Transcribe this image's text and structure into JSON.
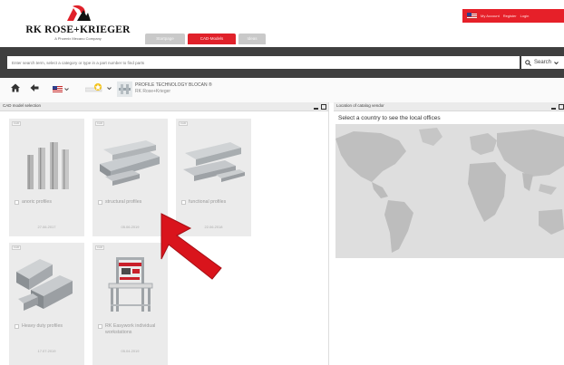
{
  "brand": {
    "name": "RK ROSE+KRIEGER",
    "tagline": "A Phoenix Mecano Company"
  },
  "tabs": [
    {
      "label": "Startpage"
    },
    {
      "label": "CAD-Models"
    },
    {
      "label": "Ideas"
    }
  ],
  "top_links": {
    "account": "My Account",
    "register": "Register",
    "login": "Login"
  },
  "search": {
    "placeholder": "Enter search term, select a category or type in a part number to find parts",
    "button_label": "Search"
  },
  "catalog": {
    "title": "PROFILE TECHNOLOGY BLOCAN ®",
    "subtitle": "RK Rose+Krieger"
  },
  "left_panel": {
    "title": "CAD model selection",
    "cards": [
      {
        "tag": "CAD",
        "label": "anoric profiles",
        "date": "27.06.2017"
      },
      {
        "tag": "CAD",
        "label": "structural profiles",
        "date": "05.06.2019"
      },
      {
        "tag": "CAD",
        "label": "functional profiles",
        "date": "22.06.2018"
      },
      {
        "tag": "CAD",
        "label": "Heavy duty profiles",
        "date": "17.07.2019"
      },
      {
        "tag": "CAD",
        "label": "RK Easywork individual workstations",
        "date": "05.04.2019"
      }
    ]
  },
  "right_panel": {
    "title": "Location of catalog vendor",
    "hint": "Select a country to see the local offices"
  },
  "colors": {
    "brand_red": "#e0212a",
    "search_band": "#3f3f3f",
    "card_bg": "#ebebeb",
    "arrow_red": "#d9141c"
  }
}
